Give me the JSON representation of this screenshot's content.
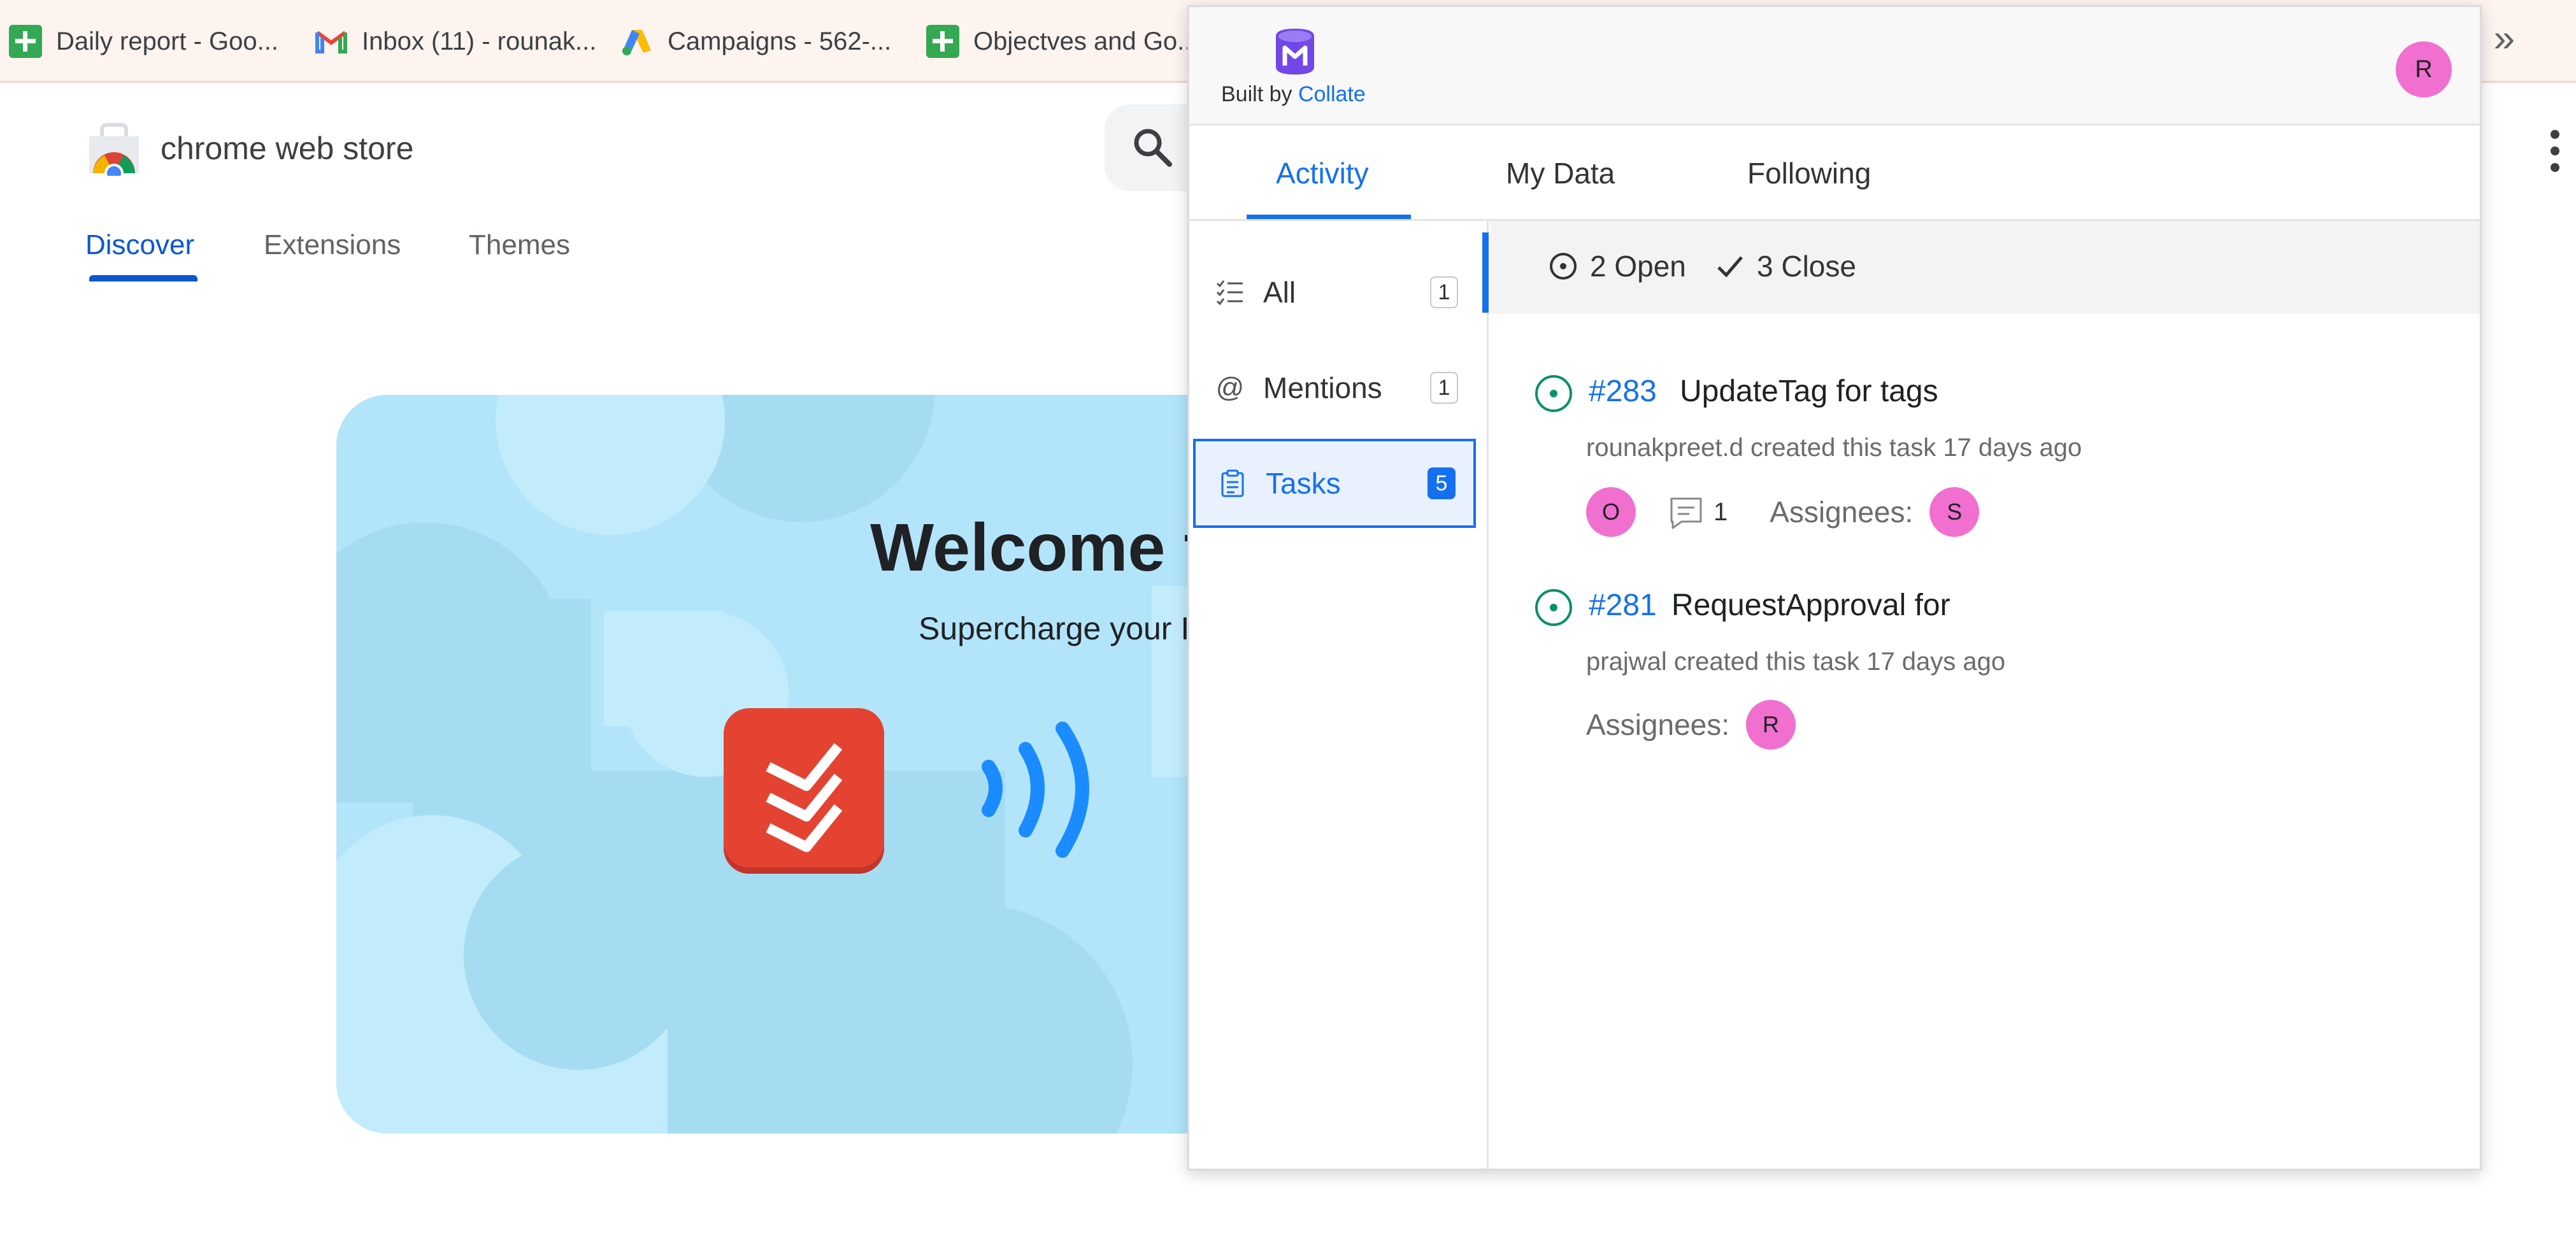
{
  "bookmarks": {
    "items": [
      {
        "label": "Daily report - Goo...",
        "icon": "sheets-icon"
      },
      {
        "label": "Inbox (11) - rounak...",
        "icon": "gmail-icon"
      },
      {
        "label": "Campaigns - 562-...",
        "icon": "google-ads-icon"
      },
      {
        "label": "Objectves and Go...",
        "icon": "sheets-icon"
      }
    ],
    "overflow": "»"
  },
  "store": {
    "title": "chrome web store",
    "nav": [
      {
        "label": "Discover",
        "active": true
      },
      {
        "label": "Extensions",
        "active": false
      },
      {
        "label": "Themes",
        "active": false
      }
    ],
    "hero": {
      "title": "Welcome t",
      "subtitle": "Supercharge your I"
    }
  },
  "popup": {
    "brand": {
      "prefix": "Built by",
      "link": "Collate"
    },
    "user_initial": "R",
    "tabs": [
      {
        "label": "Activity",
        "active": true
      },
      {
        "label": "My Data",
        "active": false
      },
      {
        "label": "Following",
        "active": false
      }
    ],
    "sidebar": [
      {
        "label": "All",
        "count": "1",
        "icon": "checklist-icon",
        "active": false
      },
      {
        "label": "Mentions",
        "count": "1",
        "icon": "at-sign-icon",
        "active": false
      },
      {
        "label": "Tasks",
        "count": "5",
        "icon": "clipboard-icon",
        "active": true
      }
    ],
    "filters": {
      "open": "2 Open",
      "closed": "3 Close"
    },
    "tasks": [
      {
        "id": "#283",
        "title": "UpdateTag for tags",
        "meta": "rounakpreet.d created this task 17 days ago",
        "owner_initial": "O",
        "comments": "1",
        "assignees_label": "Assignees:",
        "assignee_initial": "S"
      },
      {
        "id": "#281",
        "title": "RequestApproval for",
        "meta": "prajwal created this task 17 days ago",
        "assignees_label": "Assignees:",
        "assignee_initial": "R"
      }
    ]
  },
  "colors": {
    "accent": "#1470ef",
    "avatar": "#f06fcf",
    "open_status": "#0a8f6c",
    "hero_bg": "#b3e5fa"
  }
}
